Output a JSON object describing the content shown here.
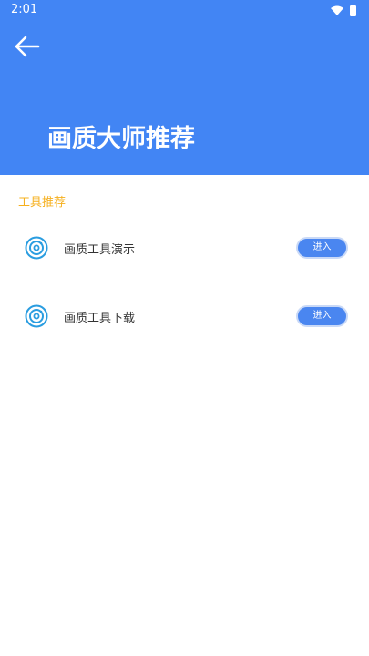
{
  "status_bar": {
    "time": "2:01"
  },
  "header": {
    "back_icon": "arrow-left-icon",
    "title": "画质大师推荐"
  },
  "section": {
    "title": "工具推荐"
  },
  "tools": [
    {
      "label": "画质工具演示",
      "button_label": "进入",
      "icon": "target-icon"
    },
    {
      "label": "画质工具下载",
      "button_label": "进入",
      "icon": "target-icon"
    }
  ],
  "colors": {
    "header_bg": "#4285f4",
    "section_title": "#f6b01e",
    "button_bg": "#4a86f0",
    "icon": "#2a9de0"
  }
}
